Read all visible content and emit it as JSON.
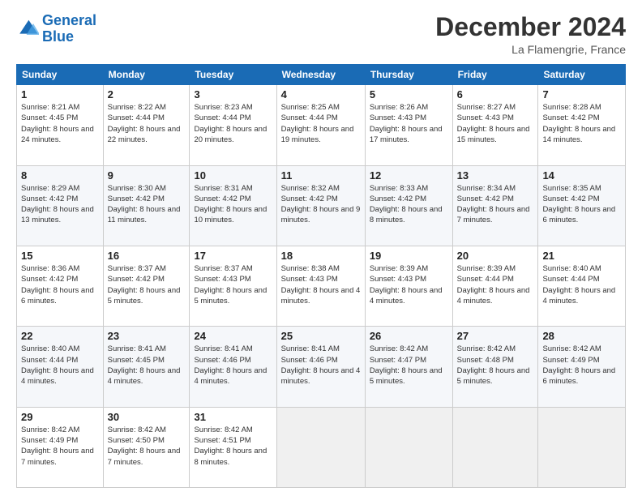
{
  "logo": {
    "line1": "General",
    "line2": "Blue"
  },
  "header": {
    "month": "December 2024",
    "location": "La Flamengrie, France"
  },
  "weekdays": [
    "Sunday",
    "Monday",
    "Tuesday",
    "Wednesday",
    "Thursday",
    "Friday",
    "Saturday"
  ],
  "weeks": [
    [
      {
        "day": "1",
        "sunrise": "8:21 AM",
        "sunset": "4:45 PM",
        "daylight": "8 hours and 24 minutes."
      },
      {
        "day": "2",
        "sunrise": "8:22 AM",
        "sunset": "4:44 PM",
        "daylight": "8 hours and 22 minutes."
      },
      {
        "day": "3",
        "sunrise": "8:23 AM",
        "sunset": "4:44 PM",
        "daylight": "8 hours and 20 minutes."
      },
      {
        "day": "4",
        "sunrise": "8:25 AM",
        "sunset": "4:44 PM",
        "daylight": "8 hours and 19 minutes."
      },
      {
        "day": "5",
        "sunrise": "8:26 AM",
        "sunset": "4:43 PM",
        "daylight": "8 hours and 17 minutes."
      },
      {
        "day": "6",
        "sunrise": "8:27 AM",
        "sunset": "4:43 PM",
        "daylight": "8 hours and 15 minutes."
      },
      {
        "day": "7",
        "sunrise": "8:28 AM",
        "sunset": "4:42 PM",
        "daylight": "8 hours and 14 minutes."
      }
    ],
    [
      {
        "day": "8",
        "sunrise": "8:29 AM",
        "sunset": "4:42 PM",
        "daylight": "8 hours and 13 minutes."
      },
      {
        "day": "9",
        "sunrise": "8:30 AM",
        "sunset": "4:42 PM",
        "daylight": "8 hours and 11 minutes."
      },
      {
        "day": "10",
        "sunrise": "8:31 AM",
        "sunset": "4:42 PM",
        "daylight": "8 hours and 10 minutes."
      },
      {
        "day": "11",
        "sunrise": "8:32 AM",
        "sunset": "4:42 PM",
        "daylight": "8 hours and 9 minutes."
      },
      {
        "day": "12",
        "sunrise": "8:33 AM",
        "sunset": "4:42 PM",
        "daylight": "8 hours and 8 minutes."
      },
      {
        "day": "13",
        "sunrise": "8:34 AM",
        "sunset": "4:42 PM",
        "daylight": "8 hours and 7 minutes."
      },
      {
        "day": "14",
        "sunrise": "8:35 AM",
        "sunset": "4:42 PM",
        "daylight": "8 hours and 6 minutes."
      }
    ],
    [
      {
        "day": "15",
        "sunrise": "8:36 AM",
        "sunset": "4:42 PM",
        "daylight": "8 hours and 6 minutes."
      },
      {
        "day": "16",
        "sunrise": "8:37 AM",
        "sunset": "4:42 PM",
        "daylight": "8 hours and 5 minutes."
      },
      {
        "day": "17",
        "sunrise": "8:37 AM",
        "sunset": "4:43 PM",
        "daylight": "8 hours and 5 minutes."
      },
      {
        "day": "18",
        "sunrise": "8:38 AM",
        "sunset": "4:43 PM",
        "daylight": "8 hours and 4 minutes."
      },
      {
        "day": "19",
        "sunrise": "8:39 AM",
        "sunset": "4:43 PM",
        "daylight": "8 hours and 4 minutes."
      },
      {
        "day": "20",
        "sunrise": "8:39 AM",
        "sunset": "4:44 PM",
        "daylight": "8 hours and 4 minutes."
      },
      {
        "day": "21",
        "sunrise": "8:40 AM",
        "sunset": "4:44 PM",
        "daylight": "8 hours and 4 minutes."
      }
    ],
    [
      {
        "day": "22",
        "sunrise": "8:40 AM",
        "sunset": "4:44 PM",
        "daylight": "8 hours and 4 minutes."
      },
      {
        "day": "23",
        "sunrise": "8:41 AM",
        "sunset": "4:45 PM",
        "daylight": "8 hours and 4 minutes."
      },
      {
        "day": "24",
        "sunrise": "8:41 AM",
        "sunset": "4:46 PM",
        "daylight": "8 hours and 4 minutes."
      },
      {
        "day": "25",
        "sunrise": "8:41 AM",
        "sunset": "4:46 PM",
        "daylight": "8 hours and 4 minutes."
      },
      {
        "day": "26",
        "sunrise": "8:42 AM",
        "sunset": "4:47 PM",
        "daylight": "8 hours and 5 minutes."
      },
      {
        "day": "27",
        "sunrise": "8:42 AM",
        "sunset": "4:48 PM",
        "daylight": "8 hours and 5 minutes."
      },
      {
        "day": "28",
        "sunrise": "8:42 AM",
        "sunset": "4:49 PM",
        "daylight": "8 hours and 6 minutes."
      }
    ],
    [
      {
        "day": "29",
        "sunrise": "8:42 AM",
        "sunset": "4:49 PM",
        "daylight": "8 hours and 7 minutes."
      },
      {
        "day": "30",
        "sunrise": "8:42 AM",
        "sunset": "4:50 PM",
        "daylight": "8 hours and 7 minutes."
      },
      {
        "day": "31",
        "sunrise": "8:42 AM",
        "sunset": "4:51 PM",
        "daylight": "8 hours and 8 minutes."
      },
      null,
      null,
      null,
      null
    ]
  ]
}
